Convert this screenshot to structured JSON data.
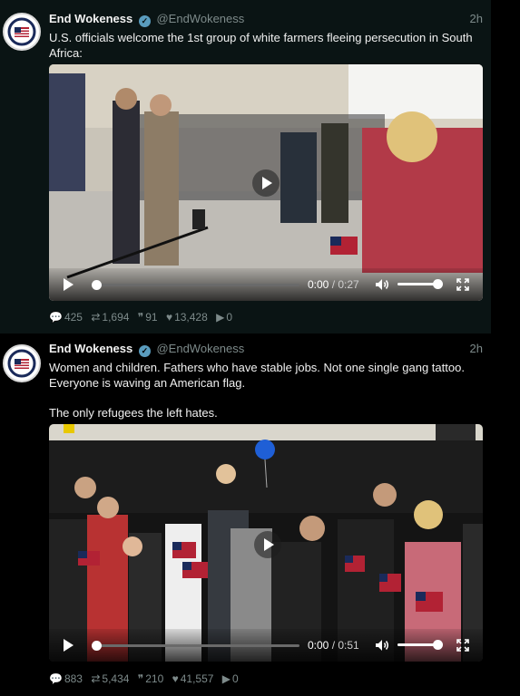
{
  "tweets": [
    {
      "author": {
        "name": "End Wokeness",
        "handle": "@EndWokeness"
      },
      "time": "2h",
      "text": [
        "U.S. officials welcome the 1st group of white farmers fleeing persecution in South Africa:"
      ],
      "video": {
        "current": "0:00",
        "separator": " / ",
        "total": "0:27",
        "progress": 0.0,
        "volume": 1.0
      },
      "stats": {
        "replies": "425",
        "retweets": "1,694",
        "quotes": "91",
        "likes": "13,428",
        "views": "0"
      }
    },
    {
      "author": {
        "name": "End Wokeness",
        "handle": "@EndWokeness"
      },
      "time": "2h",
      "text": [
        "Women and children. Fathers who have stable jobs. Not one single gang tattoo. Everyone is waving an American flag.",
        "The only refugees the left hates."
      ],
      "video": {
        "current": "0:00",
        "separator": " / ",
        "total": "0:51",
        "progress": 0.0,
        "volume": 1.0
      },
      "stats": {
        "replies": "883",
        "retweets": "5,434",
        "quotes": "210",
        "likes": "41,557",
        "views": "0"
      }
    }
  ],
  "icons": {
    "reply": "speech-bubble-icon",
    "retweet": "retweet-icon",
    "quote": "quote-icon",
    "like": "heart-icon",
    "views": "play-icon"
  },
  "colors": {
    "verified": "#5a9cbe",
    "muted": "#7d8a8a",
    "tweet1_bg": "#0a1414",
    "tweet2_bg": "#000000"
  }
}
